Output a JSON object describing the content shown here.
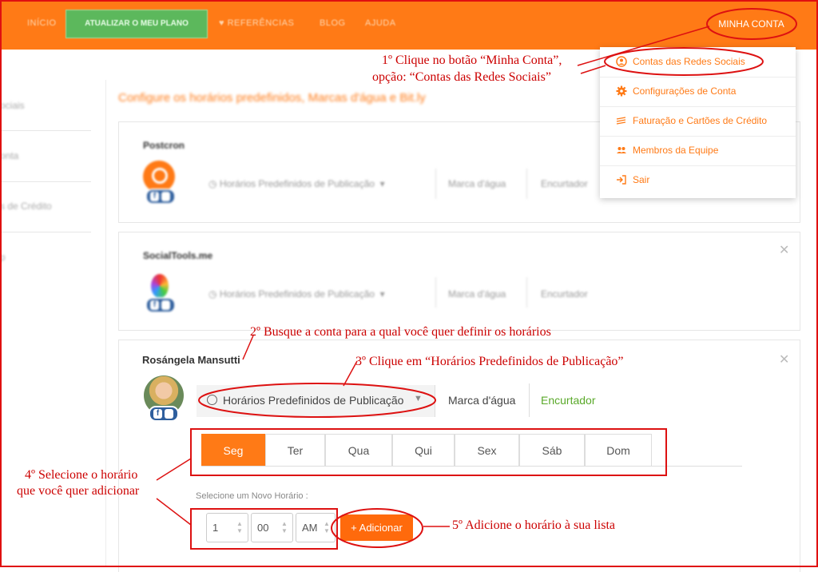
{
  "topbar": {
    "nav": [
      "INÍCIO",
      "ATUALIZAR O MEU PLANO",
      "REFERÊNCIAS",
      "BLOG",
      "AJUDA"
    ],
    "account_label": "MINHA CONTA"
  },
  "sidebar": {
    "items": [
      "ociais",
      "onta",
      "s de Crédito",
      "p"
    ]
  },
  "section_title": "Configure os horários predefinidos, Marcas d'água e Bit.ly",
  "cards": [
    {
      "name": "Postcron",
      "schedule_label": "Horários Predefinidos de Publicação",
      "watermark_label": "Marca d'água",
      "shortener_label": "Encurtador"
    },
    {
      "name": "SocialTools.me",
      "schedule_label": "Horários Predefinidos de Publicação",
      "watermark_label": "Marca d'água",
      "shortener_label": "Encurtador"
    },
    {
      "name": "Rosángela Mansutti",
      "schedule_label": "Horários Predefinidos de Publicação",
      "watermark_label": "Marca d'água",
      "shortener_label": "Encurtador"
    }
  ],
  "days": [
    "Seg",
    "Ter",
    "Qua",
    "Qui",
    "Sex",
    "Sáb",
    "Dom"
  ],
  "new_time": {
    "label": "Selecione um Novo Horário :",
    "hour": "1",
    "minute": "00",
    "period": "AM",
    "add_label": "+ Adicionar"
  },
  "dropdown": {
    "items": [
      {
        "label": "Contas das Redes Sociais",
        "icon": "user-circle-icon"
      },
      {
        "label": "Configurações de Conta",
        "icon": "gear-icon"
      },
      {
        "label": "Faturação e Cartões de Crédito",
        "icon": "money-icon"
      },
      {
        "label": "Membros da Equipe",
        "icon": "users-icon"
      },
      {
        "label": "Sair",
        "icon": "sign-out-icon"
      }
    ]
  },
  "annotations": {
    "step1_line1": "1º Clique no botão “Minha Conta”,",
    "step1_line2": "opção: “Contas das Redes Sociais”",
    "step2": "2º Busque a conta para a qual você quer definir os horários",
    "step3": "3º Clique em “Horários Predefinidos de Publicação”",
    "step4_line1": "4º Selecione o horário",
    "step4_line2": "que você quer adicionar",
    "step5": "5º Adicione o horário à sua lista"
  },
  "colors": {
    "brand_orange": "#ff7a16",
    "plan_green": "#5cb85c",
    "annotation_red": "#cc0000",
    "shortener_green": "#5aa92a"
  }
}
